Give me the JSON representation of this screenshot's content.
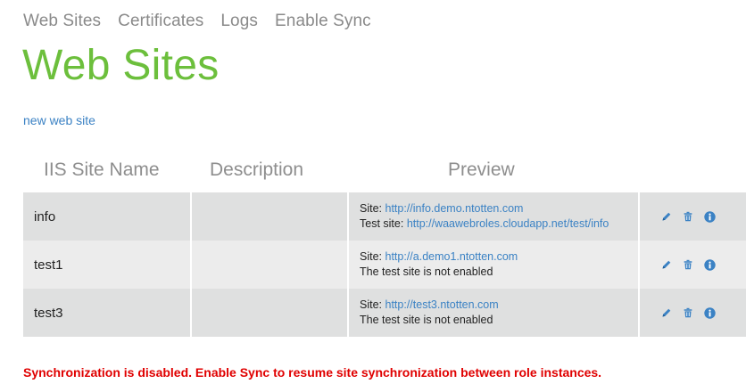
{
  "nav": {
    "items": [
      "Web Sites",
      "Certificates",
      "Logs",
      "Enable Sync"
    ]
  },
  "page": {
    "title": "Web Sites",
    "new_link": "new web site"
  },
  "table": {
    "headers": [
      "IIS Site Name",
      "Description",
      "Preview"
    ],
    "rows": [
      {
        "name": "info",
        "description": "",
        "site_prefix": "Site:",
        "site_url": "http://info.demo.ntotten.com",
        "test_prefix": "Test site:",
        "test_url": "http://waawebroles.cloudapp.net/test/info",
        "test_text": ""
      },
      {
        "name": "test1",
        "description": "",
        "site_prefix": "Site:",
        "site_url": "http://a.demo1.ntotten.com",
        "test_prefix": "",
        "test_url": "",
        "test_text": "The test site is not enabled"
      },
      {
        "name": "test3",
        "description": "",
        "site_prefix": "Site:",
        "site_url": "http://test3.ntotten.com",
        "test_prefix": "",
        "test_url": "",
        "test_text": "The test site is not enabled"
      }
    ],
    "row_actions": [
      "pencil-icon",
      "trash-icon",
      "info-icon"
    ]
  },
  "status": {
    "message": "Synchronization is disabled. Enable Sync to resume site synchronization between role instances."
  },
  "colors": {
    "accent": "#6cbf3c",
    "link": "#3b82c4",
    "error": "#e00000",
    "nav_text": "#8a8a8a",
    "row_dark": "#dfe0e0",
    "row_light": "#ececec"
  }
}
